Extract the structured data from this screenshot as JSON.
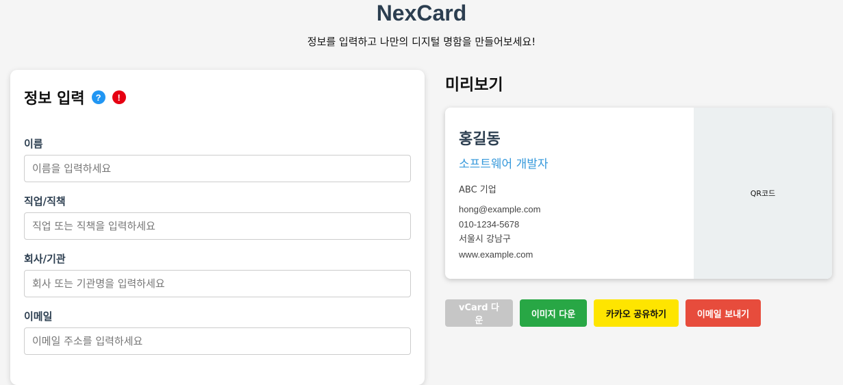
{
  "header": {
    "title": "NexCard",
    "subtitle": "정보를 입력하고 나만의 디지털 명함을 만들어보세요!"
  },
  "form": {
    "title": "정보 입력",
    "help_icon": "question-icon",
    "alert_icon": "exclamation-icon",
    "help_glyph": "?",
    "alert_glyph": "!",
    "fields": [
      {
        "label": "이름",
        "placeholder": "이름을 입력하세요",
        "value": ""
      },
      {
        "label": "직업/직책",
        "placeholder": "직업 또는 직책을 입력하세요",
        "value": ""
      },
      {
        "label": "회사/기관",
        "placeholder": "회사 또는 기관명을 입력하세요",
        "value": ""
      },
      {
        "label": "이메일",
        "placeholder": "이메일 주소를 입력하세요",
        "value": ""
      }
    ]
  },
  "preview": {
    "title": "미리보기",
    "card": {
      "name": "홍길동",
      "job": "소프트웨어 개발자",
      "company": "ABC 기업",
      "email": "hong@example.com",
      "phone": "010-1234-5678",
      "address": "서울시 강남구",
      "website": "www.example.com",
      "qr_label": "QR코드"
    }
  },
  "actions": {
    "vcard": "vCard 다운",
    "image": "이미지 다운",
    "kakao": "카카오 공유하기",
    "email": "이메일 보내기"
  },
  "colors": {
    "title": "#2c3e50",
    "accent": "#3498db",
    "help": "#2196f3",
    "alert": "#e60012",
    "vcard_btn": "#c6c6c6",
    "image_btn": "#28a745",
    "kakao_btn": "#fee500",
    "email_btn": "#e74c3c"
  }
}
